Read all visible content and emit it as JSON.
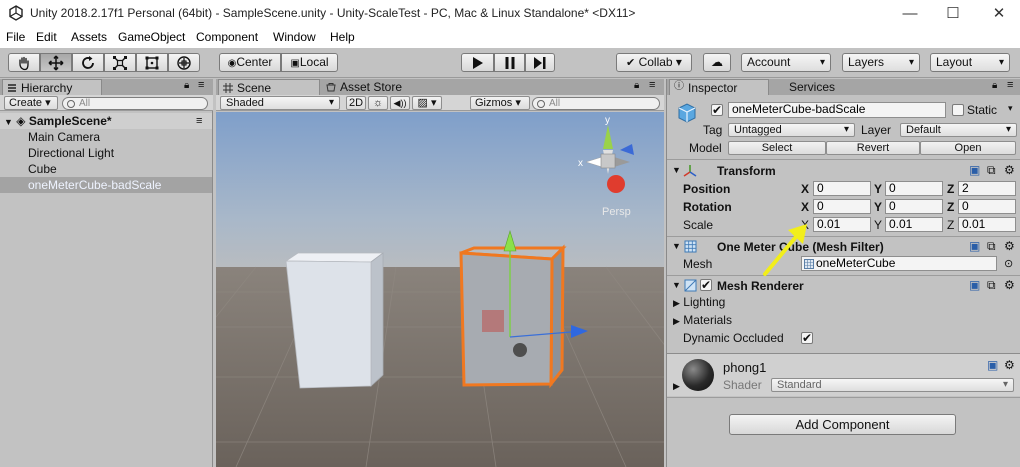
{
  "window": {
    "title": "Unity 2018.2.17f1 Personal (64bit) - SampleScene.unity - Unity-ScaleTest - PC, Mac & Linux Standalone* <DX11>",
    "minimize": "—",
    "maximize": "☐",
    "close": "✕"
  },
  "menu": [
    "File",
    "Edit",
    "Assets",
    "GameObject",
    "Component",
    "Window",
    "Help"
  ],
  "toolbar": {
    "center": "Center",
    "local": "Local",
    "collab": "Collab ▾",
    "account": "Account",
    "layers": "Layers",
    "layout": "Layout"
  },
  "hierarchy": {
    "tab": "Hierarchy",
    "create": "Create",
    "search_placeholder": "All",
    "scene": "SampleScene*",
    "items": [
      "Main Camera",
      "Directional Light",
      "Cube",
      "oneMeterCube-badScale"
    ]
  },
  "scene_view": {
    "tabs": [
      "Scene",
      "Asset Store"
    ],
    "shading": "Shaded",
    "mode_2d": "2D",
    "gizmos": "Gizmos",
    "search_placeholder": "All",
    "gizmo_axes": {
      "y": "y",
      "x": "x"
    },
    "persp": "Persp"
  },
  "inspector": {
    "tabs": [
      "Inspector",
      "Services"
    ],
    "object_name": "oneMeterCube-badScale",
    "static_label": "Static",
    "tag_label": "Tag",
    "tag_value": "Untagged",
    "layer_label": "Layer",
    "layer_value": "Default",
    "model_label": "Model",
    "model_buttons": [
      "Select",
      "Revert",
      "Open"
    ],
    "transform": {
      "title": "Transform",
      "rows": [
        {
          "label": "Position",
          "x": "0",
          "y": "0",
          "z": "2"
        },
        {
          "label": "Rotation",
          "x": "0",
          "y": "0",
          "z": "0"
        },
        {
          "label": "Scale",
          "x": "0.01",
          "y": "0.01",
          "z": "0.01"
        }
      ],
      "axis_labels": [
        "X",
        "Y",
        "Z"
      ]
    },
    "mesh_filter": {
      "title": "One Meter Cube (Mesh Filter)",
      "mesh_label": "Mesh",
      "mesh_value": "oneMeterCube"
    },
    "mesh_renderer": {
      "title": "Mesh Renderer",
      "lighting": "Lighting",
      "materials": "Materials",
      "dynamic_occluded": "Dynamic Occluded"
    },
    "material": {
      "name": "phong1",
      "shader_label": "Shader",
      "shader_value": "Standard"
    },
    "add_component": "Add Component"
  },
  "colors": {
    "selection_orange": "#f07820",
    "annotation_arrow": "#f2ee1a",
    "selected_row": "#a3b6d1"
  }
}
